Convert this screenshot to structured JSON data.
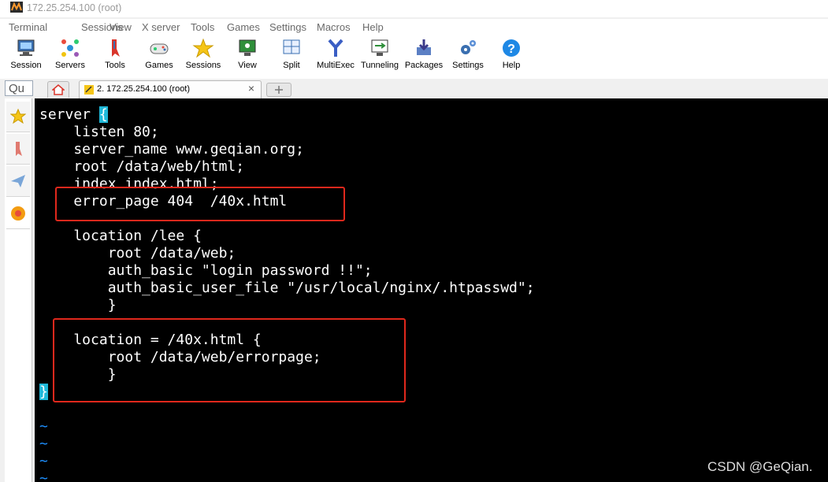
{
  "window": {
    "title": "172.25.254.100 (root)"
  },
  "menu": [
    "Terminal",
    "Sessions",
    "View",
    "X server",
    "Tools",
    "Games",
    "Settings",
    "Macros",
    "Help"
  ],
  "toolbar": [
    {
      "label": "Session",
      "icon": "session-icon"
    },
    {
      "label": "Servers",
      "icon": "servers-icon"
    },
    {
      "label": "Tools",
      "icon": "tools-icon"
    },
    {
      "label": "Games",
      "icon": "games-icon"
    },
    {
      "label": "Sessions",
      "icon": "star-icon"
    },
    {
      "label": "View",
      "icon": "view-icon"
    },
    {
      "label": "Split",
      "icon": "split-icon"
    },
    {
      "label": "MultiExec",
      "icon": "multiexec-icon"
    },
    {
      "label": "Tunneling",
      "icon": "tunneling-icon"
    },
    {
      "label": "Packages",
      "icon": "packages-icon"
    },
    {
      "label": "Settings",
      "icon": "gear-icon"
    },
    {
      "label": "Help",
      "icon": "help-icon"
    }
  ],
  "quick_connect": {
    "text": "Qu"
  },
  "tabs": {
    "active_label": "2. 172.25.254.100 (root)",
    "close": "×"
  },
  "terminal": {
    "lines": [
      {
        "pre": "server ",
        "hl": "{",
        "post": ""
      },
      {
        "pre": "    listen 80;",
        "hl": "",
        "post": ""
      },
      {
        "pre": "    server_name www.geqian.org;",
        "hl": "",
        "post": ""
      },
      {
        "pre": "    root /data/web/html;",
        "hl": "",
        "post": ""
      },
      {
        "pre": "    index index.html;",
        "hl": "",
        "post": ""
      },
      {
        "pre": "    error_page 404  /40x.html",
        "hl": "",
        "post": ""
      },
      {
        "pre": "",
        "hl": "",
        "post": ""
      },
      {
        "pre": "    location /lee {",
        "hl": "",
        "post": ""
      },
      {
        "pre": "        root /data/web;",
        "hl": "",
        "post": ""
      },
      {
        "pre": "        auth_basic \"login password !!\";",
        "hl": "",
        "post": ""
      },
      {
        "pre": "        auth_basic_user_file \"/usr/local/nginx/.htpasswd\";",
        "hl": "",
        "post": ""
      },
      {
        "pre": "        }",
        "hl": "",
        "post": ""
      },
      {
        "pre": "",
        "hl": "",
        "post": ""
      },
      {
        "pre": "    location = /40x.html {",
        "hl": "",
        "post": ""
      },
      {
        "pre": "        root /data/web/errorpage;",
        "hl": "",
        "post": ""
      },
      {
        "pre": "        }",
        "hl": "",
        "post": ""
      },
      {
        "pre": "",
        "hl": "}",
        "post": ""
      }
    ],
    "tildes": [
      "~",
      "~",
      "~",
      "~"
    ]
  },
  "watermark": "CSDN @GeQian.",
  "colors": {
    "terminal_bg": "#000000",
    "cursor": "#1fb8d8",
    "tilde": "#1e90ff",
    "annotation": "#e0281c"
  }
}
